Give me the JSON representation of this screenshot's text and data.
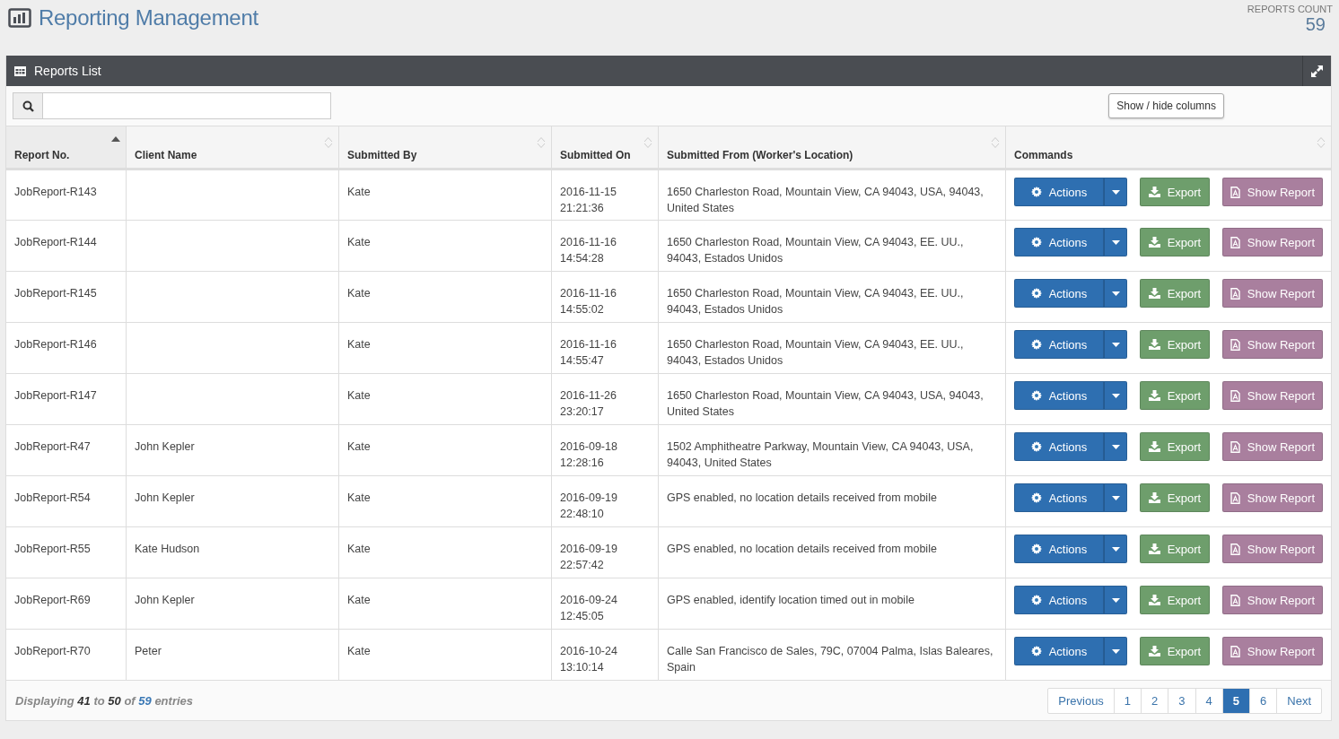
{
  "header": {
    "title": "Reporting Management",
    "count_label": "REPORTS COUNT",
    "count": "59"
  },
  "panel": {
    "title": "Reports List",
    "columns_button": "Show / hide columns"
  },
  "table": {
    "columns": [
      {
        "label": "Report No.",
        "sorted": true
      },
      {
        "label": "Client Name",
        "sorted": false
      },
      {
        "label": "Submitted By",
        "sorted": false
      },
      {
        "label": "Submitted On",
        "sorted": false
      },
      {
        "label": "Submitted From (Worker's Location)",
        "sorted": false
      },
      {
        "label": "Commands",
        "sorted": false
      }
    ],
    "rows": [
      {
        "report": "JobReport-R143",
        "client": "",
        "by": "Kate",
        "on": "2016-11-15 21:21:36",
        "from": "1650 Charleston Road, Mountain View, CA 94043, USA, 94043, United States",
        "commands": [
          {
            "kind": "actions",
            "label": "Actions"
          },
          {
            "kind": "export",
            "label": "Export"
          },
          {
            "kind": "show",
            "label": "Show Report"
          }
        ]
      },
      {
        "report": "JobReport-R144",
        "client": "",
        "by": "Kate",
        "on": "2016-11-16 14:54:28",
        "from": "1650 Charleston Road, Mountain View, CA 94043, EE. UU., 94043, Estados Unidos",
        "commands": [
          {
            "kind": "actions",
            "label": "Actions"
          },
          {
            "kind": "export",
            "label": "Export"
          },
          {
            "kind": "show",
            "label": "Show Report"
          }
        ]
      },
      {
        "report": "JobReport-R145",
        "client": "",
        "by": "Kate",
        "on": "2016-11-16 14:55:02",
        "from": "1650 Charleston Road, Mountain View, CA 94043, EE. UU., 94043, Estados Unidos",
        "commands": [
          {
            "kind": "actions",
            "label": "Actions"
          },
          {
            "kind": "export",
            "label": "Export"
          },
          {
            "kind": "show",
            "label": "Show Report"
          }
        ]
      },
      {
        "report": "JobReport-R146",
        "client": "",
        "by": "Kate",
        "on": "2016-11-16 14:55:47",
        "from": "1650 Charleston Road, Mountain View, CA 94043, EE. UU., 94043, Estados Unidos",
        "commands": [
          {
            "kind": "actions",
            "label": "Actions"
          },
          {
            "kind": "export",
            "label": "Export"
          },
          {
            "kind": "show",
            "label": "Show Report"
          }
        ]
      },
      {
        "report": "JobReport-R147",
        "client": "",
        "by": "Kate",
        "on": "2016-11-26 23:20:17",
        "from": "1650 Charleston Road, Mountain View, CA 94043, USA, 94043, United States",
        "commands": [
          {
            "kind": "actions",
            "label": "Actions"
          },
          {
            "kind": "export",
            "label": "Export"
          },
          {
            "kind": "show",
            "label": "Show Report"
          }
        ]
      },
      {
        "report": "JobReport-R47",
        "client": "John Kepler",
        "by": "Kate",
        "on": "2016-09-18 12:28:16",
        "from": "1502 Amphitheatre Parkway, Mountain View, CA 94043, USA, 94043, United States",
        "commands": [
          {
            "kind": "actions",
            "label": "Actions"
          },
          {
            "kind": "export",
            "label": "Export"
          },
          {
            "kind": "show",
            "label": "Show Report"
          }
        ]
      },
      {
        "report": "JobReport-R54",
        "client": "John Kepler",
        "by": "Kate",
        "on": "2016-09-19 22:48:10",
        "from": "GPS enabled, no location details received from mobile",
        "commands": [
          {
            "kind": "actions",
            "label": "Actions"
          },
          {
            "kind": "export",
            "label": "Export"
          },
          {
            "kind": "show",
            "label": "Show Report"
          }
        ]
      },
      {
        "report": "JobReport-R55",
        "client": "Kate Hudson",
        "by": "Kate",
        "on": "2016-09-19 22:57:42",
        "from": "GPS enabled, no location details received from mobile",
        "commands": [
          {
            "kind": "actions",
            "label": "Actions"
          },
          {
            "kind": "export",
            "label": "Export"
          },
          {
            "kind": "show",
            "label": "Show Report"
          }
        ]
      },
      {
        "report": "JobReport-R69",
        "client": "John Kepler",
        "by": "Kate",
        "on": "2016-09-24 12:45:05",
        "from": "GPS enabled, identify location timed out in mobile",
        "commands": [
          {
            "kind": "actions",
            "label": "Actions"
          },
          {
            "kind": "export",
            "label": "Export"
          },
          {
            "kind": "show",
            "label": "Show Report"
          }
        ]
      },
      {
        "report": "JobReport-R70",
        "client": "Peter",
        "by": "Kate",
        "on": "2016-10-24 13:10:14",
        "from": "Calle San Francisco de Sales, 79C, 07004 Palma, Islas Baleares, Spain",
        "commands": [
          {
            "kind": "actions",
            "label": "Actions"
          },
          {
            "kind": "export",
            "label": "Export"
          },
          {
            "kind": "show",
            "label": "Show Report"
          }
        ]
      }
    ]
  },
  "footer": {
    "summary": "Displaying **41** to **50** of **59** entries",
    "previous": "Previous",
    "next": "Next",
    "pages": [
      {
        "label": "1",
        "selected": false
      },
      {
        "label": "2",
        "selected": false
      },
      {
        "label": "3",
        "selected": false
      },
      {
        "label": "4",
        "selected": false
      },
      {
        "label": "5",
        "selected": true
      },
      {
        "label": "6",
        "selected": false
      }
    ]
  }
}
